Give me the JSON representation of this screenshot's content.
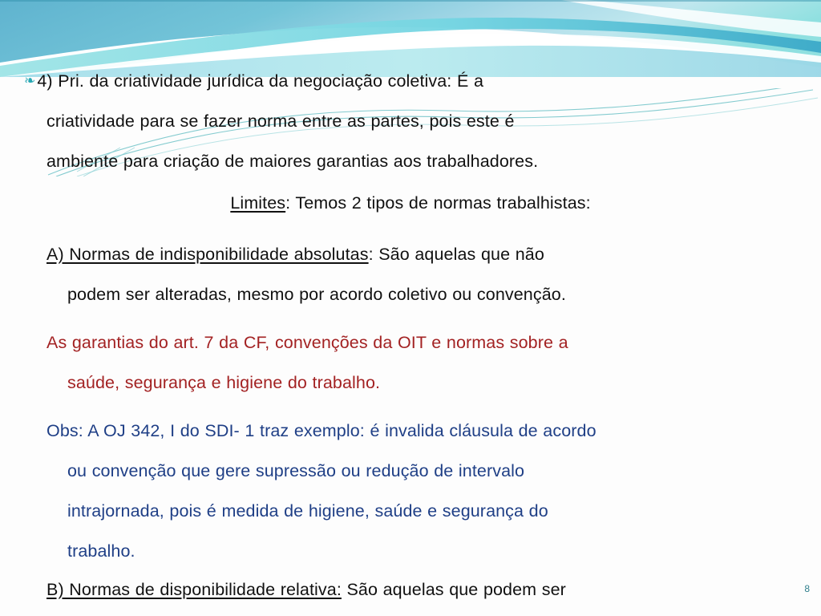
{
  "slide": {
    "number": "8",
    "background_color": "#fdfdfd",
    "accent_teal": "#28a8b4",
    "header_gradient_from": "#62b9d4",
    "header_gradient_to": "#8fe4e2"
  },
  "bullet_glyph": "❧",
  "body": {
    "principio": {
      "bullet": "❧",
      "line1": "4)  Pri.  da  criatividade  jurídica  da  negociação  coletiva:  É  a",
      "line2": "criatividade  para  se  fazer  norma  entre  as  partes,  pois  este  é",
      "line3": "ambiente para criação de maiores garantias aos trabalhadores."
    },
    "limites": {
      "underlined": "Limites",
      "rest": ": Temos 2 tipos de normas trabalhistas:"
    },
    "normas_a": {
      "underlined": "A)  Normas  de  indisponibilidade  absolutas",
      "rest": ":  São  aquelas  que  não",
      "line2": "podem ser alteradas, mesmo por acordo coletivo ou convenção."
    },
    "garantias": {
      "line1": "As  garantias  do  art.  7  da  CF,  convenções  da  OIT  e  normas  sobre  a",
      "line2": "saúde, segurança e higiene do trabalho.",
      "color": "#a32223"
    },
    "obs": {
      "line1": "Obs: A OJ 342, I do SDI- 1 traz exemplo: é invalida cláusula de acordo",
      "line2": "ou  convenção  que  gere  supressão  ou  redução  de  intervalo",
      "line3": "intrajornada,  pois  é  medida  de  higiene,  saúde  e  segurança  do",
      "line4": "trabalho.",
      "color": "#1f3f86"
    },
    "normas_b": {
      "underlined": "B)  Normas  de  disponibilidade  relativa:",
      "rest": "  São  aquelas  que  podem  ser"
    }
  }
}
